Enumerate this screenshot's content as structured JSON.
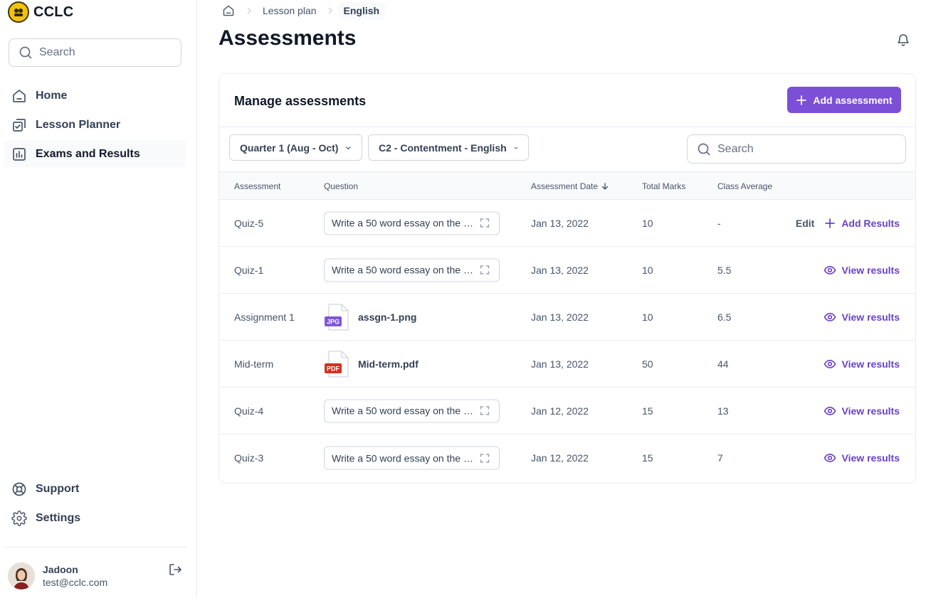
{
  "brand": {
    "name": "CCLC"
  },
  "sidebar": {
    "search_placeholder": "Search",
    "nav_items": [
      {
        "label": "Home",
        "icon": "home-icon"
      },
      {
        "label": "Lesson Planner",
        "icon": "lesson-planner-icon"
      },
      {
        "label": "Exams and Results",
        "icon": "bar-chart-icon",
        "active": true
      }
    ],
    "bottom_items": [
      {
        "label": "Support",
        "icon": "life-buoy-icon"
      },
      {
        "label": "Settings",
        "icon": "gear-icon"
      }
    ],
    "user": {
      "name": "Jadoon",
      "email": "test@cclc.com"
    }
  },
  "header": {
    "breadcrumb": [
      "Lesson plan",
      "English"
    ],
    "title": "Assessments"
  },
  "card": {
    "title": "Manage assessments",
    "add_button": "Add assessment",
    "filters": {
      "quarter": "Quarter 1 (Aug - Oct)",
      "class": "C2 - Contentment - English"
    },
    "search_placeholder": "Search",
    "columns": {
      "assessment": "Assessment",
      "question": "Question",
      "date": "Assessment Date",
      "total": "Total Marks",
      "average": "Class Average"
    },
    "rows": [
      {
        "assessment": "Quiz-5",
        "question": "Write a 50 word essay on the t...",
        "date": "Jan 13, 2022",
        "total": "10",
        "average": "-",
        "edit": "Edit",
        "action": "Add Results"
      },
      {
        "assessment": "Quiz-1",
        "question": "Write a 50 word essay on the t...",
        "date": "Jan 13, 2022",
        "total": "10",
        "average": "5.5",
        "action": "View results"
      },
      {
        "assessment": "Assignment 1",
        "file": "assgn-1.png",
        "file_badge": "JPG",
        "date": "Jan 13, 2022",
        "total": "10",
        "average": "6.5",
        "action": "View results"
      },
      {
        "assessment": "Mid-term",
        "file": "Mid-term.pdf",
        "file_badge": "PDF",
        "date": "Jan 13, 2022",
        "total": "50",
        "average": "44",
        "action": "View results"
      },
      {
        "assessment": "Quiz-4",
        "question": "Write a 50 word essay on the t...",
        "date": "Jan 12, 2022",
        "total": "15",
        "average": "13",
        "action": "View results"
      },
      {
        "assessment": "Quiz-3",
        "question": "Write a 50 word essay on the t...",
        "date": "Jan 12, 2022",
        "total": "15",
        "average": "7",
        "action": "View results"
      }
    ]
  },
  "colors": {
    "accent": "#7b4fd6",
    "link": "#6941c6",
    "jpg_badge": "#7f56d9",
    "pdf_badge": "#d92d20"
  }
}
